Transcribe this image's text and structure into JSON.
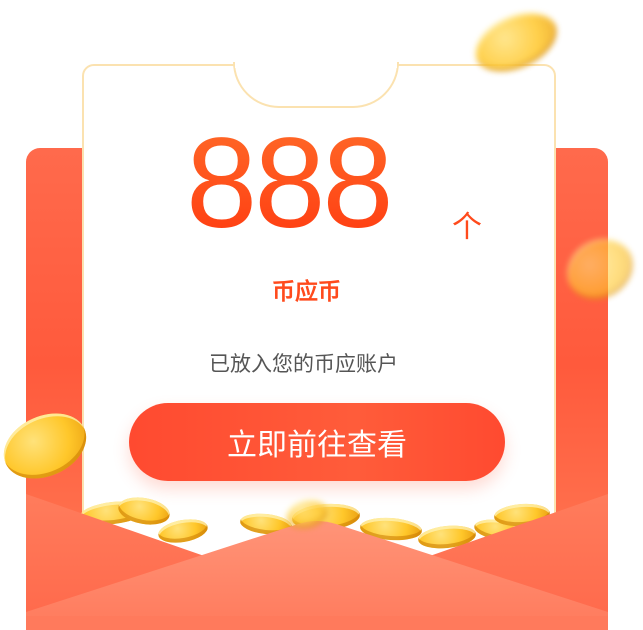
{
  "reward": {
    "amount": "888",
    "unit": "个",
    "currency_name": "币应币",
    "message": "已放入您的币应账户",
    "button_label": "立即前往查看"
  },
  "colors": {
    "accent": "#ff4a1c",
    "envelope_red": "#ff5a3c",
    "card_border": "#fbe2b0",
    "coin_gold": "#ffc72a"
  },
  "icons": [
    "coin-icon",
    "red-envelope"
  ]
}
